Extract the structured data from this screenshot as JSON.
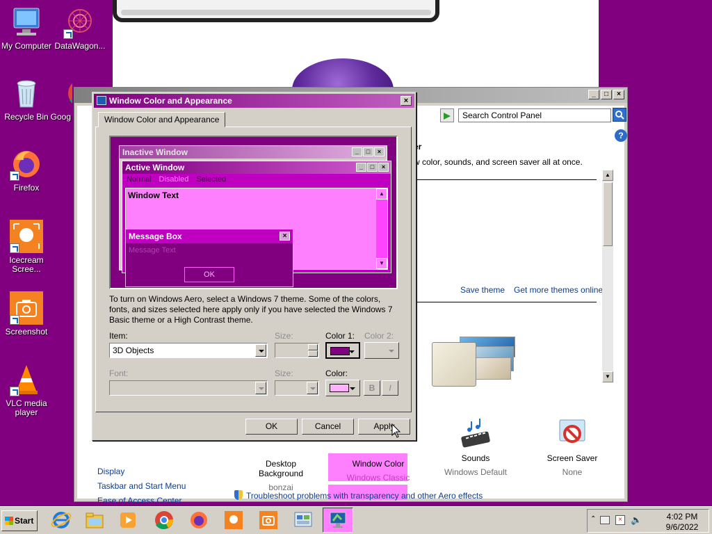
{
  "desktop": {
    "icons": [
      {
        "label": "My Computer",
        "icon": "computer-icon"
      },
      {
        "label": "DataWagon...",
        "icon": "datawagon-icon"
      },
      {
        "label": "Recycle Bin",
        "icon": "recycle-bin-icon"
      },
      {
        "label": "Goog",
        "icon": "chrome-icon"
      },
      {
        "label": "Firefox",
        "icon": "firefox-icon"
      },
      {
        "label": "Icecream Scree...",
        "icon": "icecream-icon"
      },
      {
        "label": "Screenshot",
        "icon": "screenshot-icon"
      },
      {
        "label": "VLC media player",
        "icon": "vlc-icon"
      }
    ],
    "background_color": "#800080"
  },
  "control_panel": {
    "search_placeholder": "Search Control Panel",
    "heading": "er",
    "subtitle": "w color, sounds, and screen saver all at once.",
    "save_theme": "Save theme",
    "get_more_themes": "Get more themes online",
    "left_links": [
      "Display",
      "Taskbar and Start Menu",
      "Ease of Access Center"
    ],
    "bottom_items": [
      {
        "label": "Desktop Background",
        "sub": "bonzai",
        "icon": "desktop-background-icon"
      },
      {
        "label": "Window Color",
        "sub": "Windows Classic",
        "icon": "window-color-icon"
      },
      {
        "label": "Sounds",
        "sub": "Windows Default",
        "icon": "sounds-icon"
      },
      {
        "label": "Screen Saver",
        "sub": "None",
        "icon": "screen-saver-icon"
      }
    ],
    "troubleshoot": "Troubleshoot problems with transparency and other Aero effects"
  },
  "dialog": {
    "title": "Window Color and Appearance",
    "tab": "Window Color and Appearance",
    "preview": {
      "inactive_window": "Inactive Window",
      "active_window": "Active Window",
      "menu_normal": "Normal",
      "menu_disabled": "Disabled",
      "menu_selected": "Selected",
      "window_text": "Window Text",
      "message_box": "Message Box",
      "message_text": "Message Text",
      "ok": "OK"
    },
    "info": "To turn on Windows Aero, select a Windows 7 theme.  Some of the colors, fonts, and sizes selected here apply only if you have selected the Windows 7 Basic theme or a High Contrast theme.",
    "item_label": "Item:",
    "item_value": "3D Objects",
    "size_label": "Size:",
    "color1_label": "Color 1:",
    "color2_label": "Color 2:",
    "font_label": "Font:",
    "font_size_label": "Size:",
    "color_label": "Color:",
    "bold": "B",
    "italic": "I",
    "color1_value": "#800080",
    "font_color_value": "#ffb0ff",
    "buttons": {
      "ok": "OK",
      "cancel": "Cancel",
      "apply": "Apply"
    }
  },
  "taskbar": {
    "start": "Start",
    "items": [
      "internet-explorer-icon",
      "file-explorer-icon",
      "media-player-icon",
      "chrome-icon",
      "firefox-icon",
      "icecream-icon",
      "screenshot-icon",
      "control-panel-icon",
      "display-settings-icon"
    ],
    "time": "4:02 PM",
    "date": "9/6/2022"
  }
}
